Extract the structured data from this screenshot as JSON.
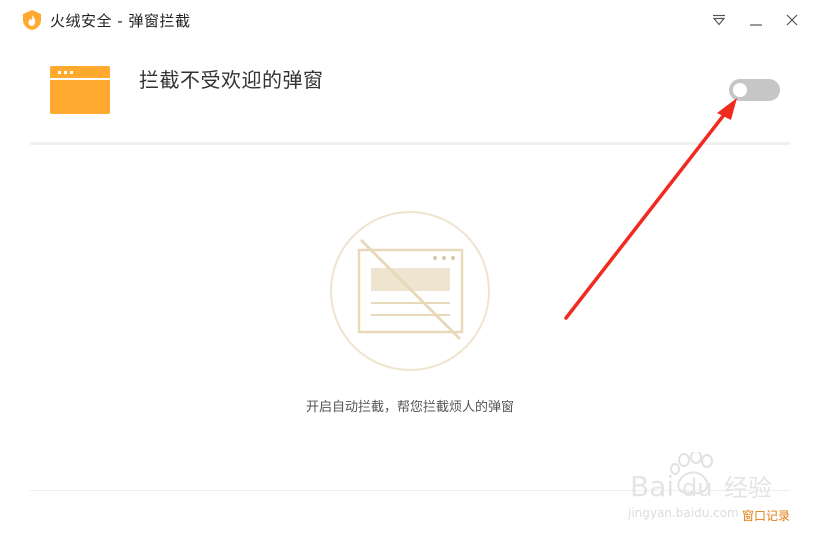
{
  "window": {
    "title": "火绒安全 - 弹窗拦截",
    "logo_icon": "huorong-flame-shield-icon",
    "controls": [
      "menu-dropdown-icon",
      "minimize-icon",
      "close-icon"
    ]
  },
  "header": {
    "icon": "browser-window-icon",
    "title": "拦截不受欢迎的弹窗",
    "toggle": {
      "state": "off"
    }
  },
  "empty_state": {
    "icon": "blocked-popup-icon",
    "message": "开启自动拦截，帮您拦截烦人的弹窗"
  },
  "footer": {
    "popup_log_label": "窗口记录"
  },
  "watermark": {
    "brand": "Bai du 经验",
    "url": "jingyan.baidu.com"
  },
  "colors": {
    "accent_orange": "#ffa92e",
    "toggle_off": "#c6c6c6",
    "illustration_tan": "#e8d9bb",
    "link_orange": "#e07d10",
    "annotation_red": "#f02a1e"
  }
}
